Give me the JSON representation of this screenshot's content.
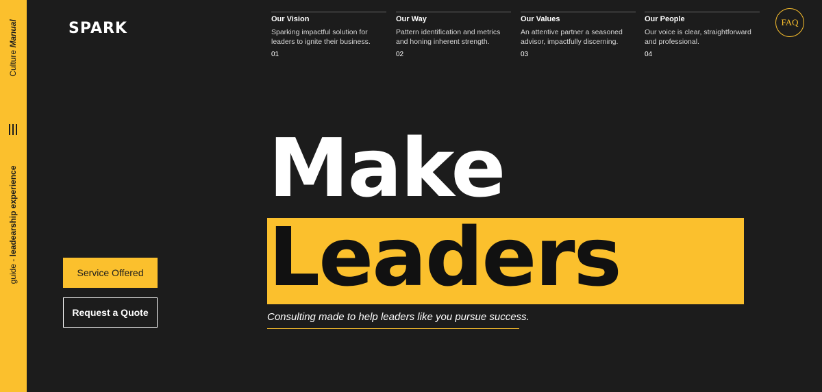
{
  "brand": {
    "logo_text": "SPARK",
    "accent_color": "#fbc02d",
    "background_color": "#1c1c1c"
  },
  "sidebar": {
    "top_label_prefix": "Culture ",
    "top_label_emphasis": "Manual",
    "bottom_label_prefix": "guide - ",
    "bottom_label_emphasis": "leadearship experience",
    "menu_icon": "hamburger-icon"
  },
  "header": {
    "faq_label": "FAQ"
  },
  "info_columns": [
    {
      "title": "Our Vision",
      "text": "Sparking impactful solution for leaders to ignite their business.",
      "number": "01"
    },
    {
      "title": "Our Way",
      "text": "Pattern identification and metrics and honing inherent strength.",
      "number": "02"
    },
    {
      "title": "Our Values",
      "text": "An attentive partner a seasoned advisor, impactfully discerning.",
      "number": "03"
    },
    {
      "title": "Our People",
      "text": "Our voice is clear, straightforward and professional.",
      "number": "04"
    }
  ],
  "hero": {
    "line1": "Make",
    "line2": "Leaders",
    "tagline": "Consulting made to help leaders like you pursue success."
  },
  "buttons": {
    "primary_label": "Service Offered",
    "secondary_label": "Request a Quote"
  }
}
